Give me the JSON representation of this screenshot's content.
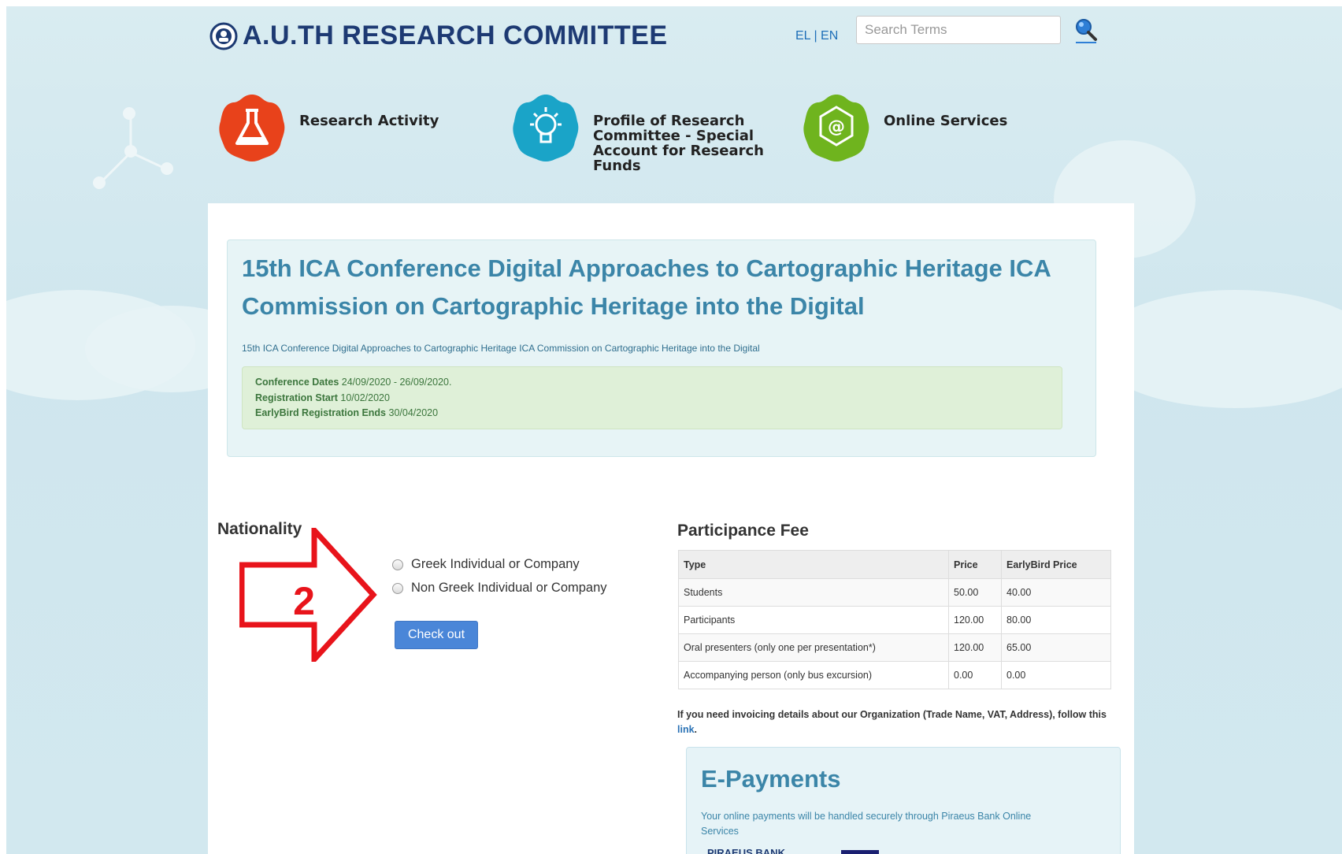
{
  "header": {
    "site_title": "A.U.TH RESEARCH COMMITTEE",
    "lang_el": "EL",
    "lang_sep": "|",
    "lang_en": "EN",
    "search_placeholder": "Search Terms"
  },
  "nav": {
    "items": [
      {
        "label_lines": [
          "Research Activity"
        ],
        "icon": "flask-icon",
        "color": "#e8421b"
      },
      {
        "label_lines": [
          "Profile of Research",
          "Committee - Special",
          "Account for Research",
          "Funds"
        ],
        "icon": "lightbulb-icon",
        "color": "#1aa4c8"
      },
      {
        "label_lines": [
          "Online Services"
        ],
        "icon": "at-sign-icon",
        "color": "#6fb41e"
      }
    ]
  },
  "conference": {
    "title": "15th ICA Conference Digital Approaches to Cartographic Heritage ICA Commission on Cartographic Heritage into the Digital",
    "subtitle": "15th ICA Conference Digital Approaches to Cartographic Heritage ICA Commission on Cartographic Heritage into the Digital",
    "dates_label": "Conference Dates",
    "dates_value": "24/09/2020 - 26/09/2020.",
    "reg_start_label": "Registration Start",
    "reg_start_value": "10/02/2020",
    "earlybird_label": "EarlyBird Registration Ends",
    "earlybird_value": "30/04/2020"
  },
  "nationality": {
    "heading": "Nationality",
    "option_greek": "Greek Individual or Company",
    "option_non_greek": "Non Greek Individual or Company",
    "checkout_label": "Check out"
  },
  "annotation": {
    "label": "2",
    "color": "#e8141b"
  },
  "fee": {
    "heading": "Participance Fee",
    "columns": [
      "Type",
      "Price",
      "EarlyBird Price"
    ],
    "rows": [
      [
        "Students",
        "50.00",
        "40.00"
      ],
      [
        "Participants",
        "120.00",
        "80.00"
      ],
      [
        "Oral presenters (only one per presentation*)",
        "120.00",
        "65.00"
      ],
      [
        "Accompanying person (only bus excursion)",
        "0.00",
        "0.00"
      ]
    ],
    "invoice_text": "If you need invoicing details about our Organization (Trade Name, VAT, Address), follow this",
    "invoice_link": "link",
    "invoice_end": "."
  },
  "epayments": {
    "heading": "E-Payments",
    "text": "Your online payments will be handled securely through Piraeus Bank Online Services",
    "bank": "PIRAEUS BANK"
  }
}
